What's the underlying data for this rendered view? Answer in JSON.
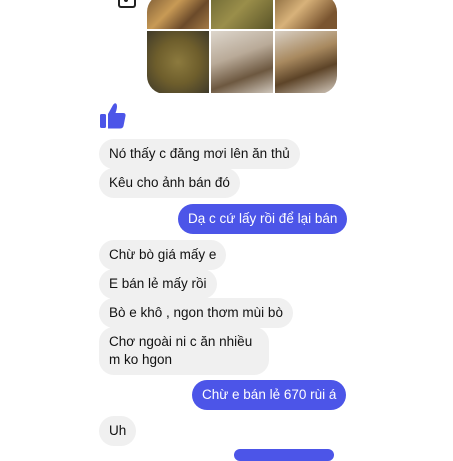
{
  "shared_photos": {
    "icons": [
      "food-photo-icon"
    ]
  },
  "reaction": {
    "icon": "thumbs-up-icon",
    "color": "#4c55e8"
  },
  "messages": [
    {
      "side": "in",
      "text": "Nó thấy c đăng mơi lên ăn thủ"
    },
    {
      "side": "in",
      "text": "Kêu cho ảnh bán đó"
    },
    {
      "side": "out",
      "text": "Dạ c cứ lấy rồi để lại bán"
    },
    {
      "side": "in",
      "text": "Chừ bò giá mấy e"
    },
    {
      "side": "in",
      "text": "E bán lẻ mấy rồi"
    },
    {
      "side": "in",
      "text": "Bò e khô , ngon thơm mùi bò"
    },
    {
      "side": "in",
      "text": "Chơ ngoài ni c ăn nhiều m ko hgon"
    },
    {
      "side": "out",
      "text": "Chừ e bán lẻ 670 rùi á"
    },
    {
      "side": "in",
      "text": "Uh"
    }
  ],
  "colors": {
    "outgoing": "#4c55e8",
    "incoming": "#f0f0f0"
  }
}
